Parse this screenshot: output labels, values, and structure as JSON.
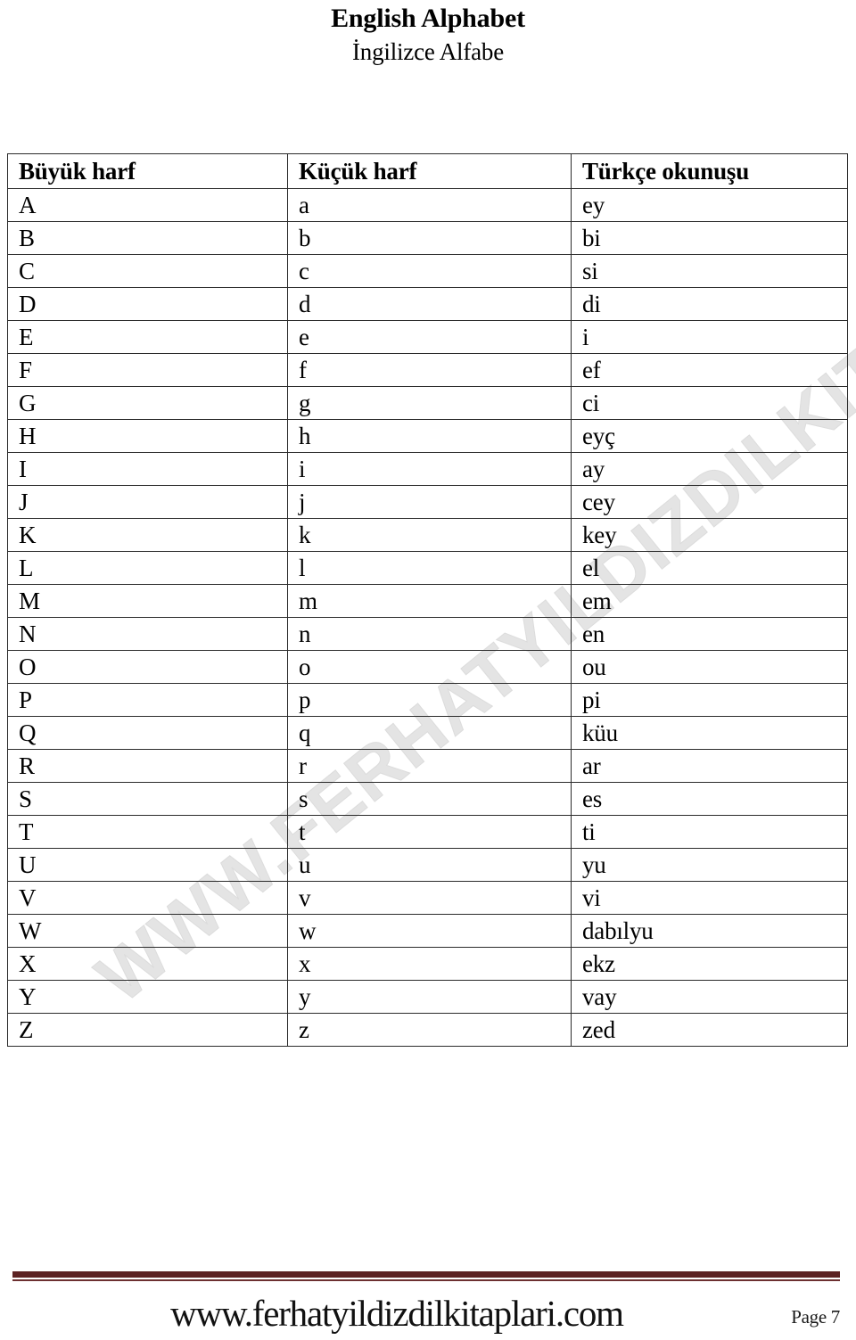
{
  "title": {
    "main": "English Alphabet",
    "sub": "İngilizce Alfabe"
  },
  "watermark": {
    "text": "WWW.FERHATYILDIZDILKITAPLARI.COM",
    "color": "#e4e4e4"
  },
  "table": {
    "headers": [
      "Büyük harf",
      "Küçük harf",
      "Türkçe okunuşu"
    ],
    "rows": [
      {
        "upper": "A",
        "lower": "a",
        "reading": "ey"
      },
      {
        "upper": "B",
        "lower": "b",
        "reading": "bi"
      },
      {
        "upper": "C",
        "lower": "c",
        "reading": "si"
      },
      {
        "upper": "D",
        "lower": "d",
        "reading": "di"
      },
      {
        "upper": "E",
        "lower": "e",
        "reading": "i"
      },
      {
        "upper": "F",
        "lower": "f",
        "reading": "ef"
      },
      {
        "upper": "G",
        "lower": "g",
        "reading": "ci"
      },
      {
        "upper": "H",
        "lower": "h",
        "reading": "eyç"
      },
      {
        "upper": "I",
        "lower": "i",
        "reading": "ay"
      },
      {
        "upper": "J",
        "lower": "j",
        "reading": "cey"
      },
      {
        "upper": "K",
        "lower": "k",
        "reading": "key"
      },
      {
        "upper": "L",
        "lower": "l",
        "reading": "el"
      },
      {
        "upper": "M",
        "lower": "m",
        "reading": "em"
      },
      {
        "upper": "N",
        "lower": "n",
        "reading": "en"
      },
      {
        "upper": "O",
        "lower": "o",
        "reading": "ou"
      },
      {
        "upper": "P",
        "lower": "p",
        "reading": "pi"
      },
      {
        "upper": "Q",
        "lower": "q",
        "reading": "küu"
      },
      {
        "upper": "R",
        "lower": "r",
        "reading": "ar"
      },
      {
        "upper": "S",
        "lower": "s",
        "reading": "es"
      },
      {
        "upper": "T",
        "lower": "t",
        "reading": "ti"
      },
      {
        "upper": "U",
        "lower": "u",
        "reading": "yu"
      },
      {
        "upper": "V",
        "lower": "v",
        "reading": "vi"
      },
      {
        "upper": "W",
        "lower": "w",
        "reading": "dabılyu"
      },
      {
        "upper": "X",
        "lower": "x",
        "reading": "ekz"
      },
      {
        "upper": "Y",
        "lower": "y",
        "reading": "vay"
      },
      {
        "upper": "Z",
        "lower": "z",
        "reading": "zed"
      }
    ]
  },
  "footer": {
    "url": "www.ferhatyildizdilkitaplari.com",
    "page": "Page 7",
    "rule_color": "#5c2223"
  }
}
